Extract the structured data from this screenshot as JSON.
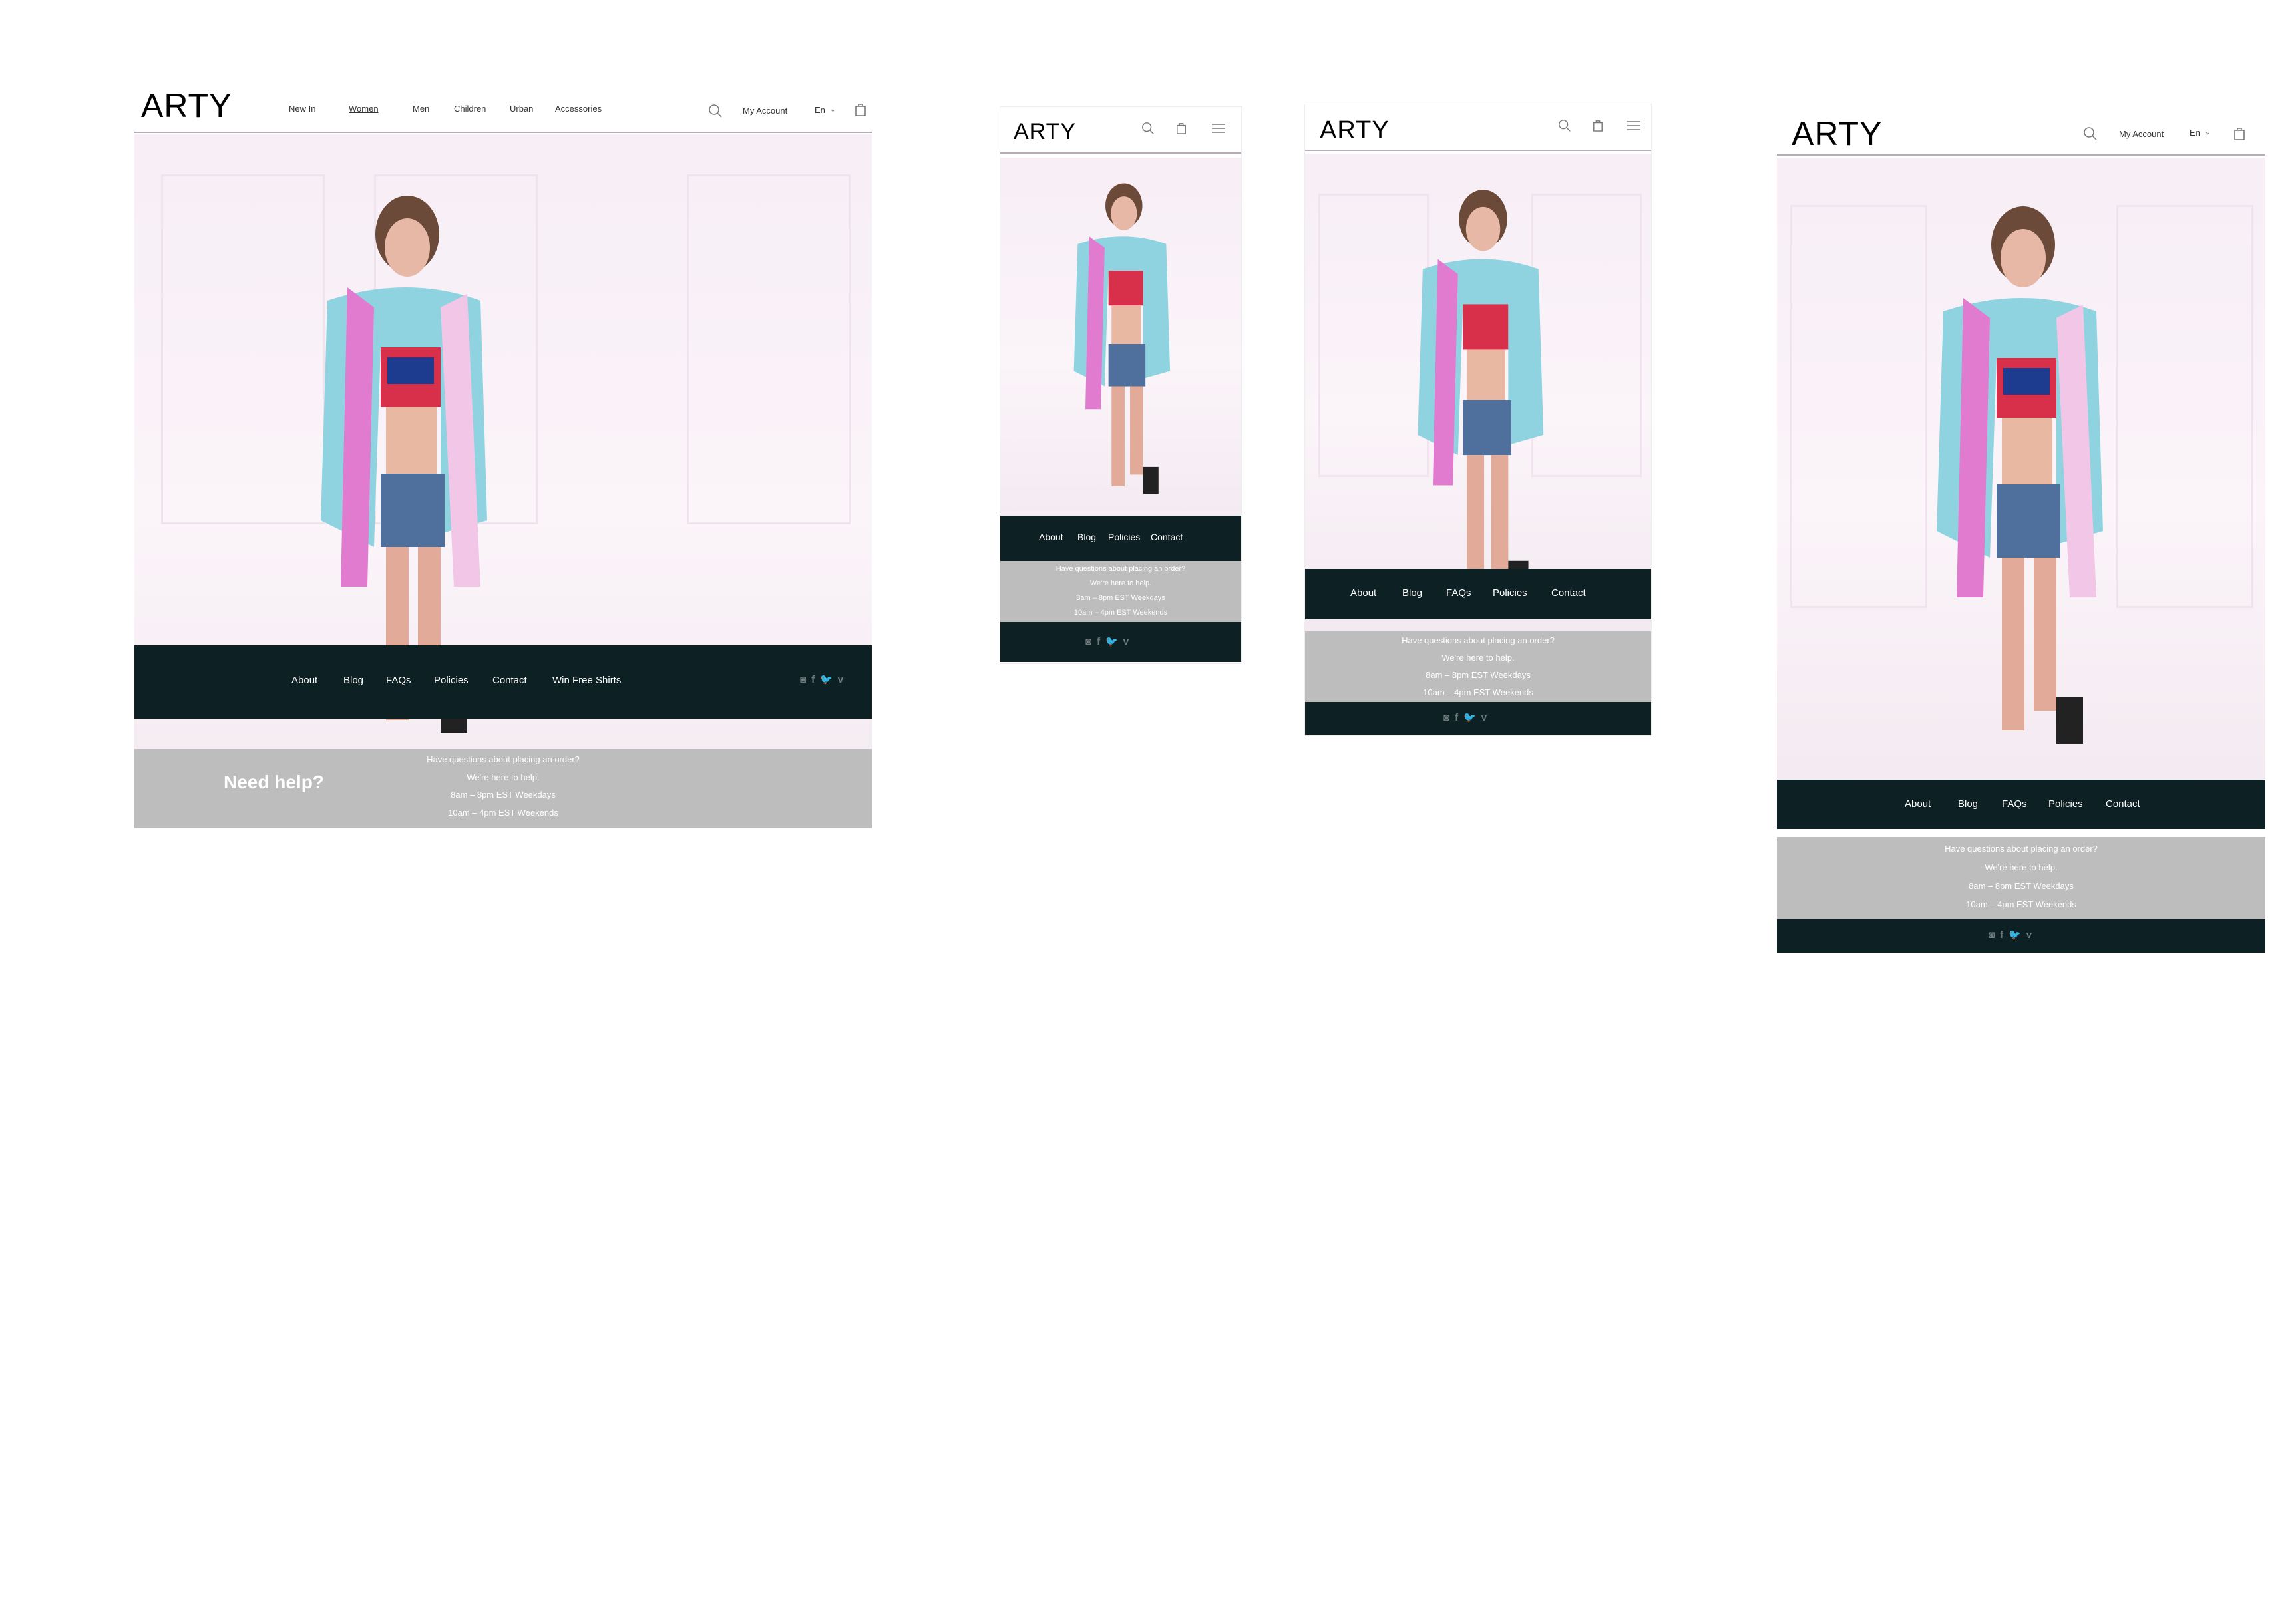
{
  "brand": {
    "logo": "ARTY"
  },
  "desktop": {
    "nav": [
      "New In",
      "Women",
      "Men",
      "Children",
      "Urban",
      "Accessories"
    ],
    "active_nav": "Women",
    "account": "My Account",
    "language": "En",
    "footer_links": [
      "About",
      "Blog",
      "FAQs",
      "Policies",
      "Contact",
      "Win Free Shirts"
    ],
    "help_title": "Need help?",
    "help_lines": [
      "Have questions about placing an order?",
      "We're here to help.",
      "8am – 8pm EST Weekdays",
      "10am – 4pm EST Weekends"
    ]
  },
  "mobile_small": {
    "footer_links": [
      "About",
      "Blog",
      "Policies",
      "Contact"
    ],
    "help_lines": [
      "Have questions about placing an order?",
      "We're here to help.",
      "8am – 8pm EST Weekdays",
      "10am – 4pm EST Weekends"
    ]
  },
  "mobile_medium": {
    "footer_links": [
      "About",
      "Blog",
      "FAQs",
      "Policies",
      "Contact"
    ],
    "help_lines": [
      "Have questions about placing an order?",
      "We're here to help.",
      "8am – 8pm EST Weekdays",
      "10am – 4pm EST Weekends"
    ]
  },
  "tablet": {
    "account": "My Account",
    "language": "En",
    "footer_links": [
      "About",
      "Blog",
      "FAQs",
      "Policies",
      "Contact"
    ],
    "help_lines": [
      "Have questions about placing an order?",
      "We're here to help.",
      "8am – 8pm EST Weekdays",
      "10am – 4pm EST Weekends"
    ]
  },
  "social": {
    "icons": [
      "instagram-icon",
      "facebook-icon",
      "twitter-icon",
      "vimeo-icon"
    ],
    "glyphs": [
      "◙",
      "f",
      "🐦",
      "v"
    ]
  },
  "colors": {
    "dark_bar": "#0d2024",
    "grey_bar": "#bdbdbd",
    "accent_line": "#b9aab9"
  }
}
